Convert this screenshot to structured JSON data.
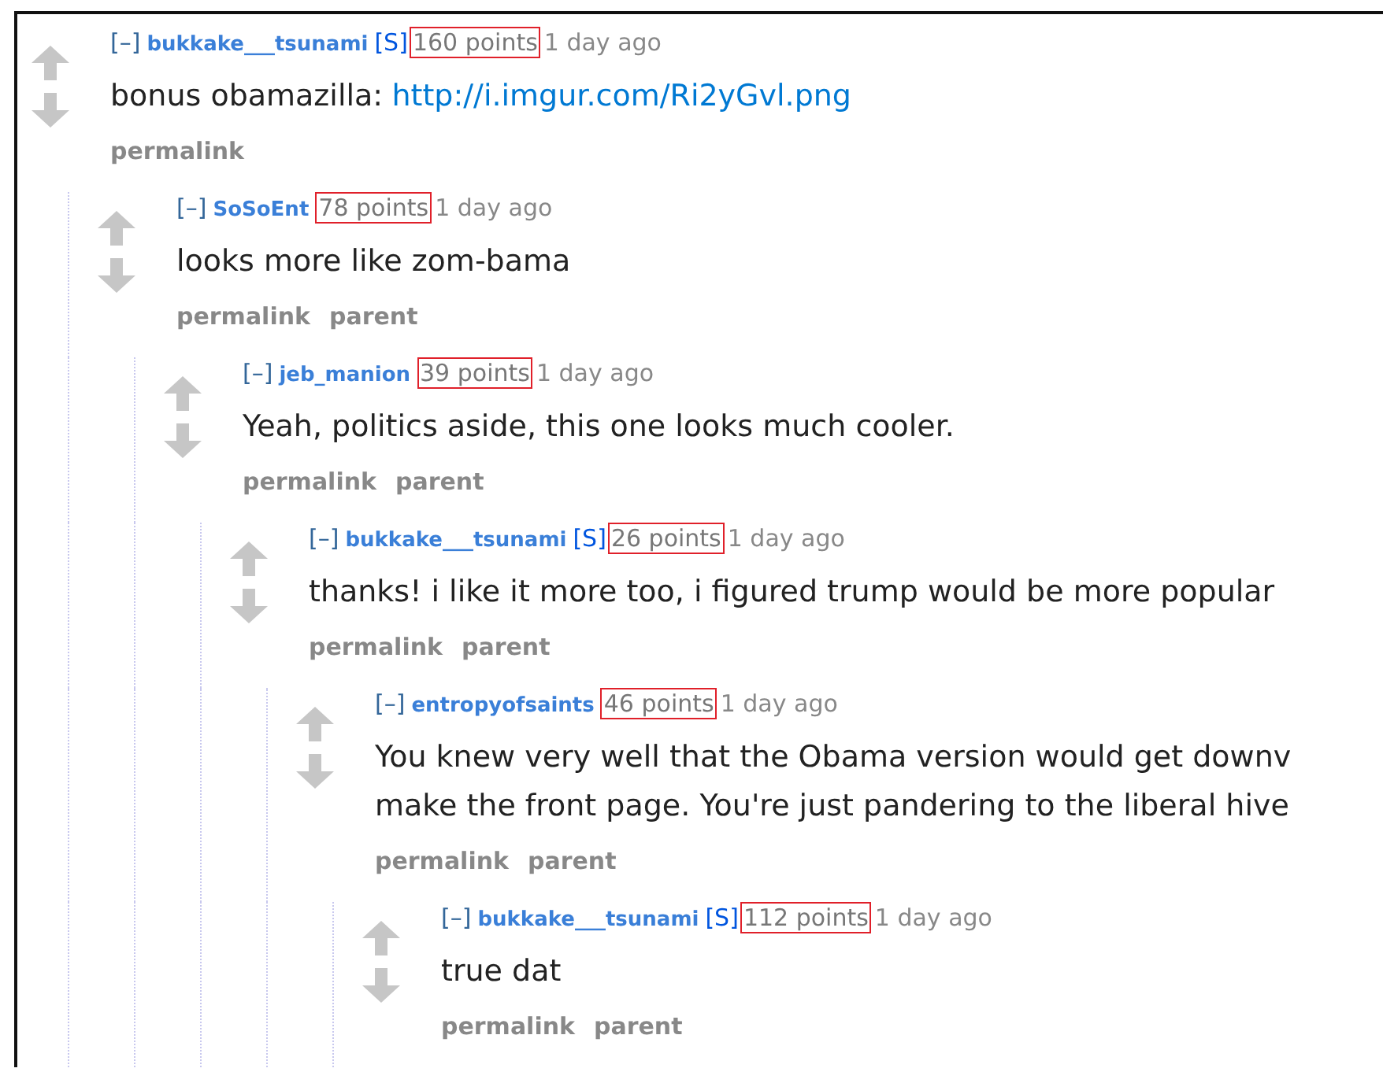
{
  "comments": [
    {
      "user": "bukkake___tsunami",
      "submitter_tag": "[S]",
      "points": "160 points",
      "time": "1 day ago",
      "body_lines": [
        "bonus obamazilla:"
      ],
      "link": "http://i.imgur.com/Ri2yGvl.png",
      "actions": [
        "permalink"
      ],
      "children": [
        {
          "user": "SoSoEnt",
          "points": "78 points",
          "time": "1 day ago",
          "body_lines": [
            "looks more like zom-bama"
          ],
          "actions": [
            "permalink",
            "parent"
          ],
          "children": [
            {
              "user": "jeb_manion",
              "points": "39 points",
              "time": "1 day ago",
              "body_lines": [
                "Yeah, politics aside, this one looks much cooler."
              ],
              "actions": [
                "permalink",
                "parent"
              ],
              "children": [
                {
                  "user": "bukkake___tsunami",
                  "submitter_tag": "[S]",
                  "points": "26 points",
                  "time": "1 day ago",
                  "body_lines": [
                    "thanks! i like it more too, i figured trump would be more popular"
                  ],
                  "actions": [
                    "permalink",
                    "parent"
                  ],
                  "children": [
                    {
                      "user": "entropyofsaints",
                      "points": "46 points",
                      "time": "1 day ago",
                      "body_lines": [
                        "You knew very well that the Obama version would get downv",
                        "make the front page. You're just pandering to the liberal hive"
                      ],
                      "actions": [
                        "permalink",
                        "parent"
                      ],
                      "children": [
                        {
                          "user": "bukkake___tsunami",
                          "submitter_tag": "[S]",
                          "points": "112 points",
                          "time": "1 day ago",
                          "body_lines": [
                            "true dat"
                          ],
                          "actions": [
                            "permalink",
                            "parent"
                          ]
                        }
                      ]
                    }
                  ]
                }
              ]
            }
          ]
        }
      ]
    }
  ],
  "collapse_label": "[–]"
}
